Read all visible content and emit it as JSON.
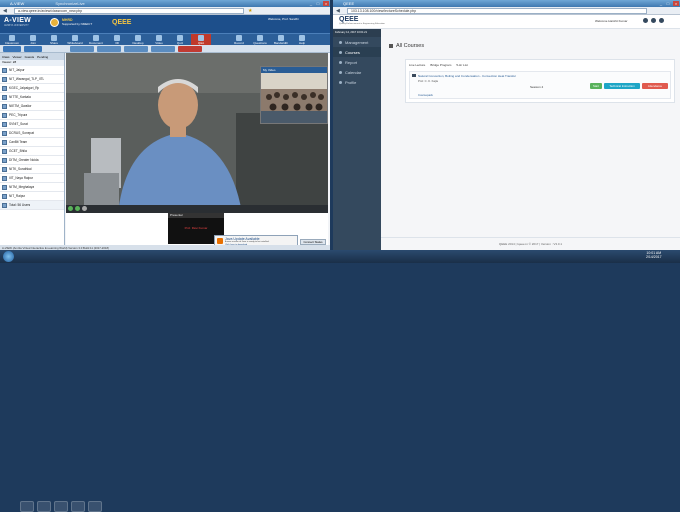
{
  "left_window": {
    "tab_title": "A-VIEW",
    "tab2_title": "SynchronizeLive",
    "address": "a-view.qeee.in/aview/classroom_new.php",
    "app_brand": "A-VIEW",
    "app_brand_sub": "AMRITA UNIVERSITY",
    "sponsor_title": "MHRD",
    "sponsor_sub": "Supported by NMEICT",
    "qeee_label": "QEEE",
    "welcome_text": "Welcome, Prof. Sandhi",
    "toolbar": [
      "Classroom",
      "Join",
      "Share",
      "Whiteboard",
      "Document",
      "3D",
      "Desktop",
      "Video",
      "Quiz",
      "Q&A",
      "Feedback",
      "Chat",
      "Settings",
      "Help"
    ],
    "right_toolbar": [
      "Record",
      "Questions",
      "Bandwidth",
      "Help"
    ],
    "people_tabs": [
      "Class",
      "Viewer",
      "Guests",
      "Pending",
      "Moderator"
    ],
    "people_header": "Viewer: 28",
    "people": [
      {
        "name": "NIT_Jaipur",
        "sub": "2006"
      },
      {
        "name": "NIT_Warangal_TLP_IITL",
        "sub": "1006"
      },
      {
        "name": "KGEC_Jalpaiguri_Rp",
        "sub": "2005"
      },
      {
        "name": "NITTE_Karkala",
        "sub": "1006"
      },
      {
        "name": "NIETM_Gwalior",
        "sub": "2008"
      },
      {
        "name": "PEC_Tripura",
        "sub": "2009"
      },
      {
        "name": "SVNIT_Surat",
        "sub": "2003"
      },
      {
        "name": "DCRUS_Sonepat",
        "sub": "2004"
      },
      {
        "name": "CanBit Team",
        "sub": "2001"
      },
      {
        "name": "GCET_Bhilai",
        "sub": "1005"
      },
      {
        "name": "DITM_Greater Noida",
        "sub": "2004"
      },
      {
        "name": "NITK_Surathkal",
        "sub": "1005"
      },
      {
        "name": "IIIT_Naya Raipur",
        "sub": "2007"
      },
      {
        "name": "NITM_Meghalaya",
        "sub": "1008"
      },
      {
        "name": "NIT_Raipur",
        "sub": "2003"
      },
      {
        "name": "Total: 56 Users",
        "sub": ""
      }
    ],
    "video_overlay_title": "My Video",
    "presenter_label": "Presenter",
    "presenter_name": "Prof. Ravi Kumar",
    "status_bar": "A-VIEW (Amrita Virtual Interactive E-Learning World) Version 3.0 Build 11 (2017-2018)",
    "connect_label": "Connected",
    "notification_title": "Java Update Available",
    "notification_sub": "A new version of Java is ready to be installed.",
    "notification_link": "Click here to download",
    "connect_btn": "Connect Status"
  },
  "right_window": {
    "tab_title": "QEEE",
    "address": "103.13.108.100/view/lectureSchedule.php",
    "brand": "QEEE",
    "brand_sub": "Quality Enhancement in Engineering Education",
    "welcome": "Welcome Harshit Kumar",
    "date_time": "February 14, 2017 10:01:21",
    "sidebar": [
      "Management",
      "Courses",
      "Report",
      "Calendar",
      "Profile"
    ],
    "page_title": "All Courses",
    "filter_items": [
      "Live Lecture",
      "Bridge Program",
      "5-Hr List"
    ],
    "course_title": "Natural Convection, Boiling and Condensation - Convection Heat Transfer",
    "course_prof": "Prof. C. K. Kajla",
    "course_session": "Session 4",
    "course_meta": "Coursepack",
    "btn_start": "Start",
    "btn_info": "Technical Instruction",
    "btn_attendance": "Attendance",
    "footer": "QEEE 2014 | Iqeee.in © 2017 | Version : V3.0.1"
  },
  "taskbar": {
    "time": "10:01 AM",
    "date": "2/14/2017"
  },
  "colors": {
    "aview_header": "#1d4f8b",
    "qeee_green": "#6ab04c",
    "qeee_sidebar": "#34495e",
    "start_btn": "#59b25c",
    "info_btn": "#1ea6c6",
    "attendance_btn": "#e05a4e"
  }
}
